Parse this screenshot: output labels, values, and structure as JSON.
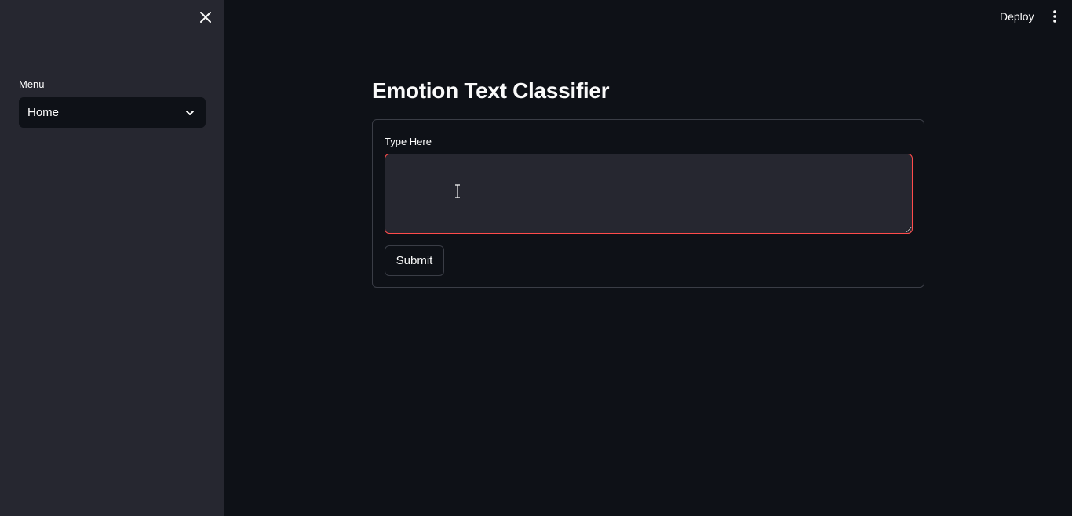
{
  "sidebar": {
    "close_icon": "close-icon",
    "menu_label": "Menu",
    "select": {
      "selected_value": "Home",
      "icon": "chevron-down-icon"
    },
    "background": "#262730"
  },
  "header": {
    "deploy_label": "Deploy",
    "menu_icon": "kebab-menu-icon"
  },
  "main": {
    "title": "Emotion Text Classifier",
    "form": {
      "field_label": "Type Here",
      "textarea_value": "",
      "submit_label": "Submit"
    }
  },
  "colors": {
    "background": "#0e1117",
    "sidebar": "#262730",
    "focus_border": "#ff4b4b",
    "text": "#fafafa"
  }
}
